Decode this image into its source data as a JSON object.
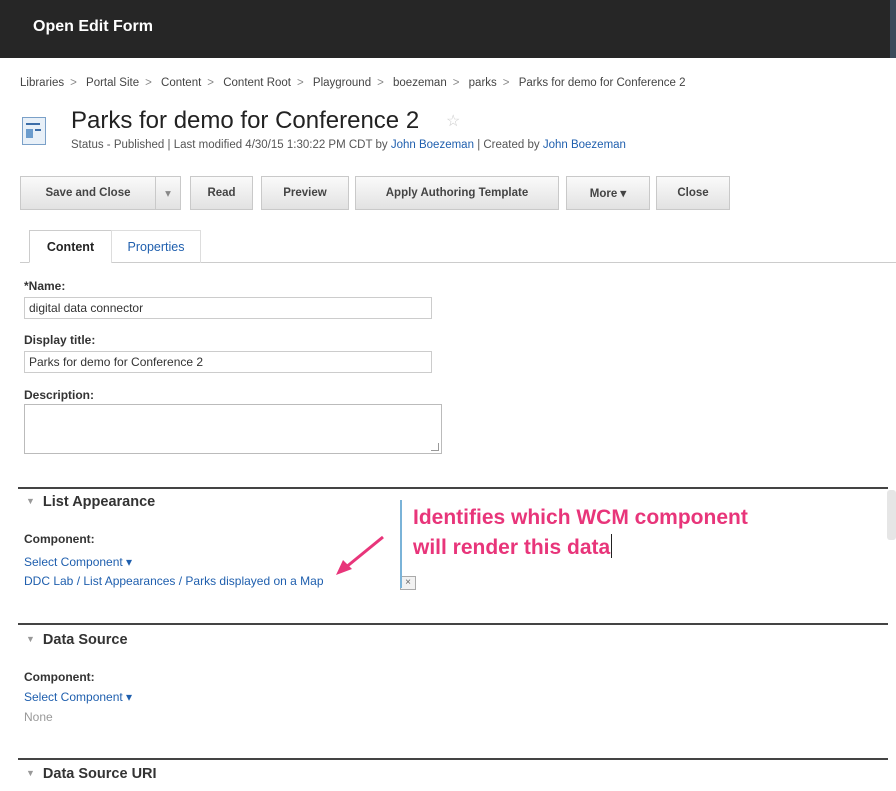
{
  "window": {
    "title": "Open Edit Form"
  },
  "breadcrumb": [
    "Libraries",
    "Portal Site",
    "Content",
    "Content Root",
    "Playground",
    "boezeman",
    "parks",
    "Parks for demo for Conference 2"
  ],
  "breadcrumb_sep": ">",
  "page": {
    "title": "Parks for demo for Conference 2",
    "status_prefix": "Status - Published | Last modified 4/30/15 1:30:22 PM CDT by",
    "modified_by": "John Boezeman",
    "created_prefix": "| Created by",
    "created_by": "John Boezeman"
  },
  "toolbar": {
    "save_close": "Save and Close",
    "dropdown": "▾",
    "read": "Read",
    "preview": "Preview",
    "apply_template": "Apply Authoring Template",
    "more": "More ▾",
    "close": "Close"
  },
  "tabs": [
    "Content",
    "Properties"
  ],
  "form": {
    "name_label": "*Name:",
    "name_value": "digital data connector",
    "display_title_label": "Display title:",
    "display_title_value": "Parks for demo for Conference 2",
    "description_label": "Description:"
  },
  "sections": {
    "list_appearance": {
      "title": "List Appearance",
      "component_label": "Component:",
      "select_label": "Select Component ▾",
      "selected_value": "DDC Lab / List Appearances / Parks displayed on a Map",
      "remove_glyph": "×"
    },
    "data_source": {
      "title": "Data Source",
      "component_label": "Component:",
      "select_label": "Select Component ▾",
      "value": "None"
    },
    "data_source_uri": {
      "title": "Data Source URI"
    }
  },
  "annotation": {
    "line1": "Identifies which WCM component",
    "line2": "will render this data",
    "color": "#e8357a"
  },
  "colors": {
    "titlebar": "#262626",
    "link": "#1f5fae",
    "accent": "#e8357a"
  }
}
